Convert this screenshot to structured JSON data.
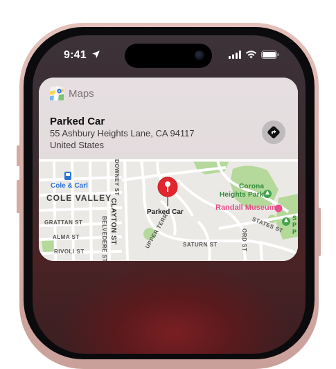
{
  "status_bar": {
    "time": "9:41",
    "icons": [
      "location-arrow-icon",
      "cellular-signal-icon",
      "wifi-icon",
      "battery-icon"
    ]
  },
  "notification": {
    "app_name": "Maps",
    "app_icon": "maps-app-icon",
    "title": "Parked Car",
    "address_line1": "55 Ashbury Heights Lane, CA  94117",
    "address_line2": "United States",
    "directions_icon": "directions-arrow-icon"
  },
  "map": {
    "pin_label": "Parked Car",
    "pin_icon": "map-pin-icon",
    "transit_label": "Cole & Carl",
    "neighborhood": "COLE VALLEY",
    "streets": {
      "downey": "DOWNEY ST",
      "clayton": "CLAYTON ST",
      "grattan": "GRATTAN ST",
      "belvedere": "BELVEDERE ST",
      "alma": "ALMA ST",
      "rivoli": "RIVOLI ST",
      "upper_terr": "UPPER TERR",
      "saturn": "SATURN ST",
      "ord": "ORD ST",
      "states": "STATES ST"
    },
    "poi": {
      "corona_line1": "Corona",
      "corona_line2": "Heights Park",
      "randall": "Randall Museum",
      "side_park": "S P P"
    }
  },
  "colors": {
    "phone_frame": "#e0b8b2",
    "pin_red": "#e2262e",
    "park_green": "#a9d18e",
    "museum_pink": "#e84e8a",
    "transit_blue": "#2b74d8"
  }
}
